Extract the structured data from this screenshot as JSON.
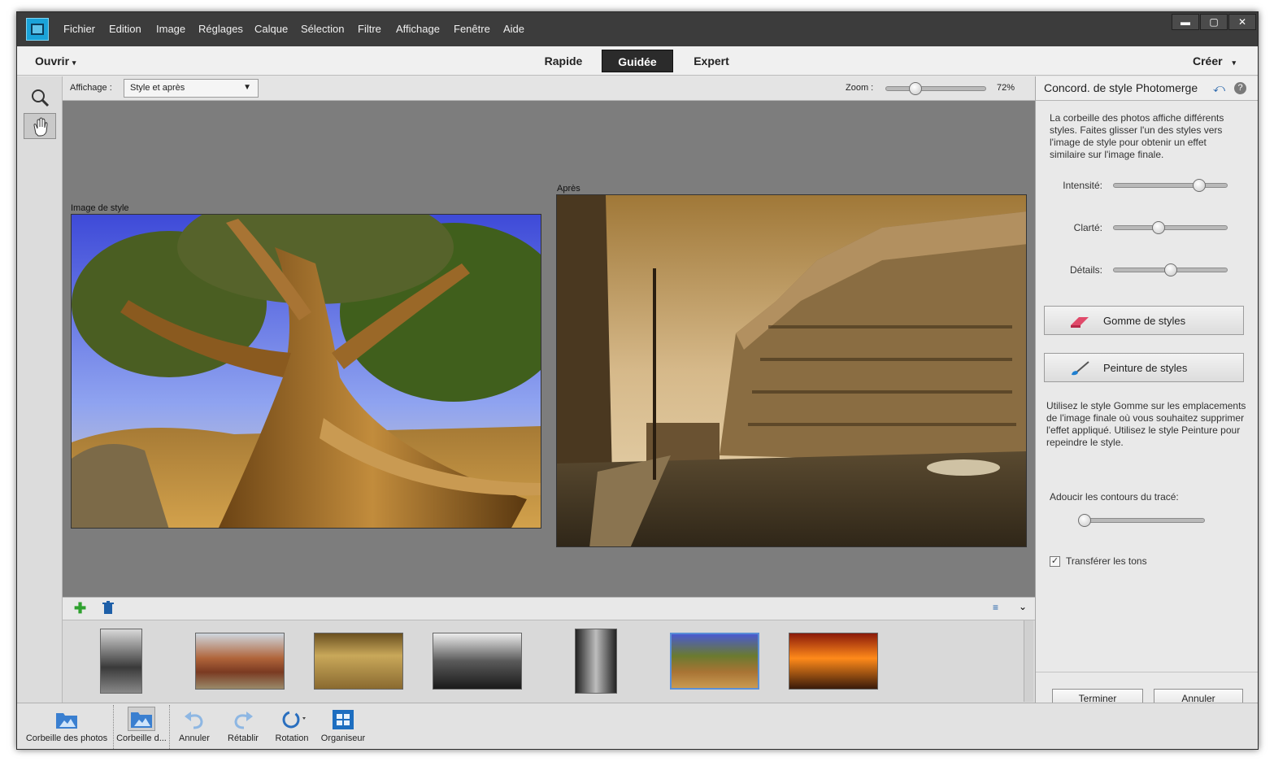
{
  "menu": [
    "Fichier",
    "Edition",
    "Image",
    "Réglages",
    "Calque",
    "Sélection",
    "Filtre",
    "Affichage",
    "Fenêtre",
    "Aide"
  ],
  "window_controls": {
    "minimize": "▬",
    "maximize": "▢",
    "close": "✕"
  },
  "modebar": {
    "open_label": "Ouvrir",
    "quick": "Rapide",
    "guided": "Guidée",
    "expert": "Expert",
    "create_label": "Créer"
  },
  "options": {
    "view_label": "Affichage :",
    "view_value": "Style et après",
    "zoom_label": "Zoom :",
    "zoom_value": "72%",
    "zoom_level_percent": 30
  },
  "canvas": {
    "style_image_label": "Image de style",
    "after_label": "Après"
  },
  "panel": {
    "title": "Concord. de style Photomerge",
    "intro": "La corbeille des photos affiche différents styles. Faites glisser l'un des styles vers l'image de style pour obtenir un effet similaire sur l'image finale.",
    "sliders": [
      {
        "label": "Intensité:",
        "value_percent": 75
      },
      {
        "label": "Clarté:",
        "value_percent": 40
      },
      {
        "label": "Détails:",
        "value_percent": 50
      }
    ],
    "eraser_button": "Gomme de styles",
    "paint_button": "Peinture de styles",
    "help_text": "Utilisez le style Gomme sur les emplacements de l'image finale où vous souhaitez supprimer l'effet appliqué. Utilisez le style Peinture pour repeindre le style.",
    "smooth_label": "Adoucir les contours du tracé:",
    "smooth_value_percent": 0,
    "transfer_tones_label": "Transférer les tons",
    "transfer_tones_checked": true,
    "done_button": "Terminer",
    "cancel_button": "Annuler"
  },
  "bin_thumbnails": [
    "rocky-coast-bw",
    "rusty-truck",
    "sepia-western-town",
    "cathedral-bw",
    "statue-bw",
    "bristlecone-tree",
    "sunset-shipwreck"
  ],
  "bottombar": {
    "photo_bin": "Corbeille des photos",
    "photo_bin2": "Corbeille d...",
    "undo": "Annuler",
    "redo": "Rétablir",
    "rotate": "Rotation",
    "organizer": "Organiseur"
  },
  "colors": {
    "accent": "#1aa3d9",
    "titlebar": "#3c3c3c",
    "canvas": "#7d7d7d",
    "selected_thumb": "#5b8fd6"
  }
}
